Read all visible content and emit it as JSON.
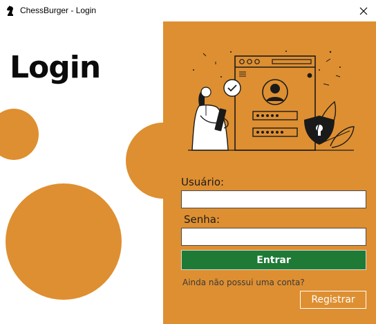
{
  "window": {
    "title": "ChessBurger - Login",
    "app_icon": "chess-knight-icon",
    "close_icon": "close-icon"
  },
  "left": {
    "heading": "Login"
  },
  "form": {
    "user_label": "Usuário:",
    "user_value": "",
    "password_label": "Senha:",
    "password_value": "",
    "enter_label": "Entrar",
    "no_account_text": "Ainda não possui uma conta?",
    "register_label": "Registrar"
  },
  "colors": {
    "accent": "#de8f31",
    "enter_button": "#1f7a35"
  }
}
